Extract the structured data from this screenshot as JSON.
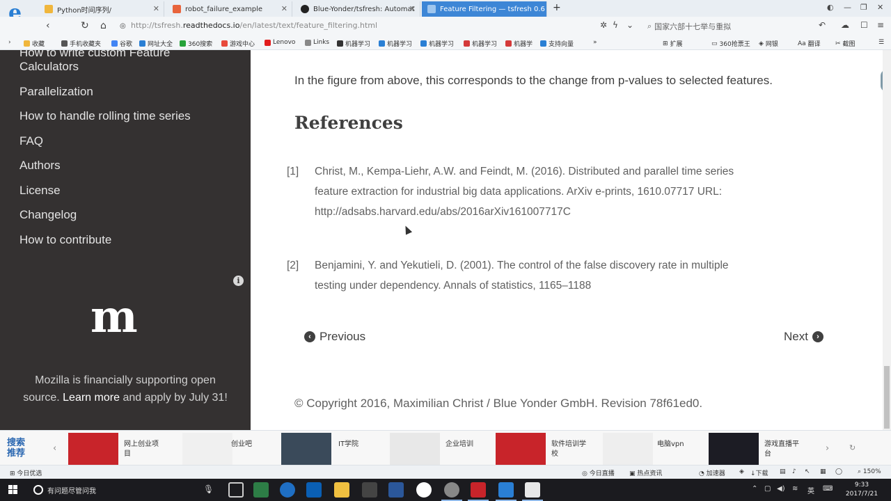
{
  "browser": {
    "tabs": [
      {
        "label": "Python时间序列/",
        "icon_color": "#f0b63c",
        "active": false
      },
      {
        "label": "robot_failure_example",
        "icon_color": "#e8643c",
        "active": false
      },
      {
        "label": "Blue-Yonder/tsfresh: Automat",
        "icon_color": "#222222",
        "active": false
      },
      {
        "label": "Feature Filtering — tsfresh 0.6",
        "icon_color": "#9fc6ee",
        "active": true
      }
    ],
    "url_prefix": "http://tsfresh.",
    "url_domain": "readthedocs.io",
    "url_path": "/en/latest/text/feature_filtering.html",
    "search_placeholder": "国家六部十七举与重拟",
    "bookmarks": [
      {
        "label": "收藏",
        "color": "#f0b63c"
      },
      {
        "label": "手机收藏夹",
        "color": "#555555"
      },
      {
        "label": "谷歌",
        "color": "#4285f4"
      },
      {
        "label": "网址大全",
        "color": "#2a7fd4"
      },
      {
        "label": "360搜索",
        "color": "#27a33a"
      },
      {
        "label": "游戏中心",
        "color": "#e84a3c"
      },
      {
        "label": "Lenovo",
        "color": "#e21d1d"
      },
      {
        "label": "Links",
        "color": "#888888"
      },
      {
        "label": "机器学习",
        "color": "#333333"
      },
      {
        "label": "机器学习",
        "color": "#2a7fd4"
      },
      {
        "label": "机器学习",
        "color": "#2a7fd4"
      },
      {
        "label": "机器学习",
        "color": "#d43a3a"
      },
      {
        "label": "机器学",
        "color": "#d43a3a"
      },
      {
        "label": "支持向量",
        "color": "#2a7fd4"
      }
    ],
    "bookmark_right": [
      {
        "label": "扩展"
      },
      {
        "label": "360抢票王"
      },
      {
        "label": "网银"
      },
      {
        "label": "翻译"
      },
      {
        "label": "截图"
      }
    ]
  },
  "sidebar": {
    "items": [
      {
        "label": "How to write custom Feature"
      },
      {
        "label": "Calculators"
      },
      {
        "label": "Parallelization"
      },
      {
        "label": "How to handle rolling time series"
      },
      {
        "label": "FAQ"
      },
      {
        "label": "Authors"
      },
      {
        "label": "License"
      },
      {
        "label": "Changelog"
      },
      {
        "label": "How to contribute"
      }
    ],
    "info_icon": "i",
    "mozilla_logo": "m",
    "mozilla_text_1": "Mozilla is financially supporting open",
    "mozilla_text_2": "source.",
    "mozilla_link": "Learn more",
    "mozilla_text_3": "and apply by July 31!"
  },
  "main": {
    "intro": "In the figure from above, this corresponds to the change from p-values to selected features.",
    "references_heading": "References",
    "references": [
      {
        "num": "[1]",
        "lines": [
          "Christ, M., Kempa-Liehr, A.W. and Feindt, M. (2016). Distributed and parallel time series",
          "feature extraction for industrial big data applications. ArXiv e-prints, 1610.07717 URL:",
          "http://adsabs.harvard.edu/abs/2016arXiv161007717C"
        ]
      },
      {
        "num": "[2]",
        "lines": [
          "Benjamini, Y. and Yekutieli, D. (2001). The control of the false discovery rate in multiple",
          "testing under dependency. Annals of statistics, 1165–1188"
        ]
      }
    ],
    "previous_label": "Previous",
    "next_label": "Next",
    "copyright": "© Copyright 2016, Maximilian Christ / Blue Yonder GmbH. Revision 78f61ed0."
  },
  "adbar": {
    "title": "搜索推荐",
    "items": [
      {
        "label": "网上创业项目",
        "thumb_color": "#c8242a"
      },
      {
        "label": "创业吧",
        "thumb_color": "#f0f0f0"
      },
      {
        "label": "IT学院",
        "thumb_color": "#3a4a5a"
      },
      {
        "label": "企业培训",
        "thumb_color": "#e8e8e8"
      },
      {
        "label": "软件培训学校",
        "thumb_color": "#c8242a"
      },
      {
        "label": "电脑vpn",
        "thumb_color": "#eeeeee"
      },
      {
        "label": "游戏直播平台",
        "thumb_color": "#1c1c24"
      }
    ]
  },
  "statusbar": {
    "left": "今日优选",
    "items": [
      "今日直播",
      "热点资讯",
      "加速器",
      "下载"
    ],
    "zoom": "150%"
  },
  "taskbar": {
    "search_text": "有问题尽管问我",
    "tray_lang": "英",
    "time": "9:33",
    "date": "2017/7/21"
  }
}
